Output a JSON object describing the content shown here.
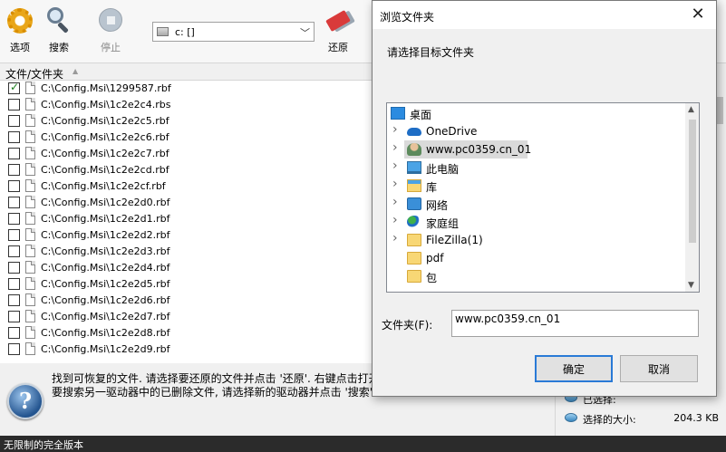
{
  "toolbar": {
    "options_label": "选项",
    "search_label": "搜索",
    "stop_label": "停止",
    "restore_label": "还原",
    "drive_value": "c: []"
  },
  "file_list": {
    "column_header": "文件/文件夹",
    "rows": [
      {
        "name": "C:\\Config.Msi\\1299587.rbf",
        "checked": true
      },
      {
        "name": "C:\\Config.Msi\\1c2e2c4.rbs",
        "checked": false
      },
      {
        "name": "C:\\Config.Msi\\1c2e2c5.rbf",
        "checked": false
      },
      {
        "name": "C:\\Config.Msi\\1c2e2c6.rbf",
        "checked": false
      },
      {
        "name": "C:\\Config.Msi\\1c2e2c7.rbf",
        "checked": false
      },
      {
        "name": "C:\\Config.Msi\\1c2e2cd.rbf",
        "checked": false
      },
      {
        "name": "C:\\Config.Msi\\1c2e2cf.rbf",
        "checked": false
      },
      {
        "name": "C:\\Config.Msi\\1c2e2d0.rbf",
        "checked": false
      },
      {
        "name": "C:\\Config.Msi\\1c2e2d1.rbf",
        "checked": false
      },
      {
        "name": "C:\\Config.Msi\\1c2e2d2.rbf",
        "checked": false
      },
      {
        "name": "C:\\Config.Msi\\1c2e2d3.rbf",
        "checked": false
      },
      {
        "name": "C:\\Config.Msi\\1c2e2d4.rbf",
        "checked": false
      },
      {
        "name": "C:\\Config.Msi\\1c2e2d5.rbf",
        "checked": false
      },
      {
        "name": "C:\\Config.Msi\\1c2e2d6.rbf",
        "checked": false
      },
      {
        "name": "C:\\Config.Msi\\1c2e2d7.rbf",
        "checked": false
      },
      {
        "name": "C:\\Config.Msi\\1c2e2d8.rbf",
        "checked": false
      },
      {
        "name": "C:\\Config.Msi\\1c2e2d9.rbf",
        "checked": false
      }
    ]
  },
  "help": {
    "line1": "找到可恢复的文件. 请选择要还原的文件并点击 '还原'. 右键点击打开",
    "line2": "要搜索另一驱动器中的已删除文件, 请选择新的驱动器并点击 '搜索'"
  },
  "stats": {
    "selected_label": "已选择:",
    "selected_size_label": "选择的大小:",
    "selected_size_value": "204.3 KB"
  },
  "status_bar": {
    "text": "无限制的完全版本"
  },
  "dialog": {
    "title": "浏览文件夹",
    "prompt": "请选择目标文件夹",
    "tree": [
      {
        "label": "桌面",
        "icon": "desktop-icon",
        "expander": false,
        "indent": 0,
        "selected": false
      },
      {
        "label": "OneDrive",
        "icon": "onedrive-icon",
        "expander": true,
        "indent": 1,
        "selected": false
      },
      {
        "label": "www.pc0359.cn_01",
        "icon": "user-icon",
        "expander": true,
        "indent": 1,
        "selected": true
      },
      {
        "label": "此电脑",
        "icon": "computer-icon",
        "expander": true,
        "indent": 1,
        "selected": false
      },
      {
        "label": "库",
        "icon": "library-icon",
        "expander": true,
        "indent": 1,
        "selected": false
      },
      {
        "label": "网络",
        "icon": "network-icon",
        "expander": true,
        "indent": 1,
        "selected": false
      },
      {
        "label": "家庭组",
        "icon": "homegroup-icon",
        "expander": true,
        "indent": 1,
        "selected": false
      },
      {
        "label": "FileZilla(1)",
        "icon": "folder-icon",
        "expander": true,
        "indent": 1,
        "selected": false
      },
      {
        "label": "pdf",
        "icon": "folder-icon",
        "expander": false,
        "indent": 1,
        "selected": false
      },
      {
        "label": "包",
        "icon": "folder-icon",
        "expander": false,
        "indent": 1,
        "selected": false
      }
    ],
    "folder_label": "文件夹(F):",
    "folder_value": "www.pc0359.cn_01",
    "ok_label": "确定",
    "cancel_label": "取消"
  }
}
